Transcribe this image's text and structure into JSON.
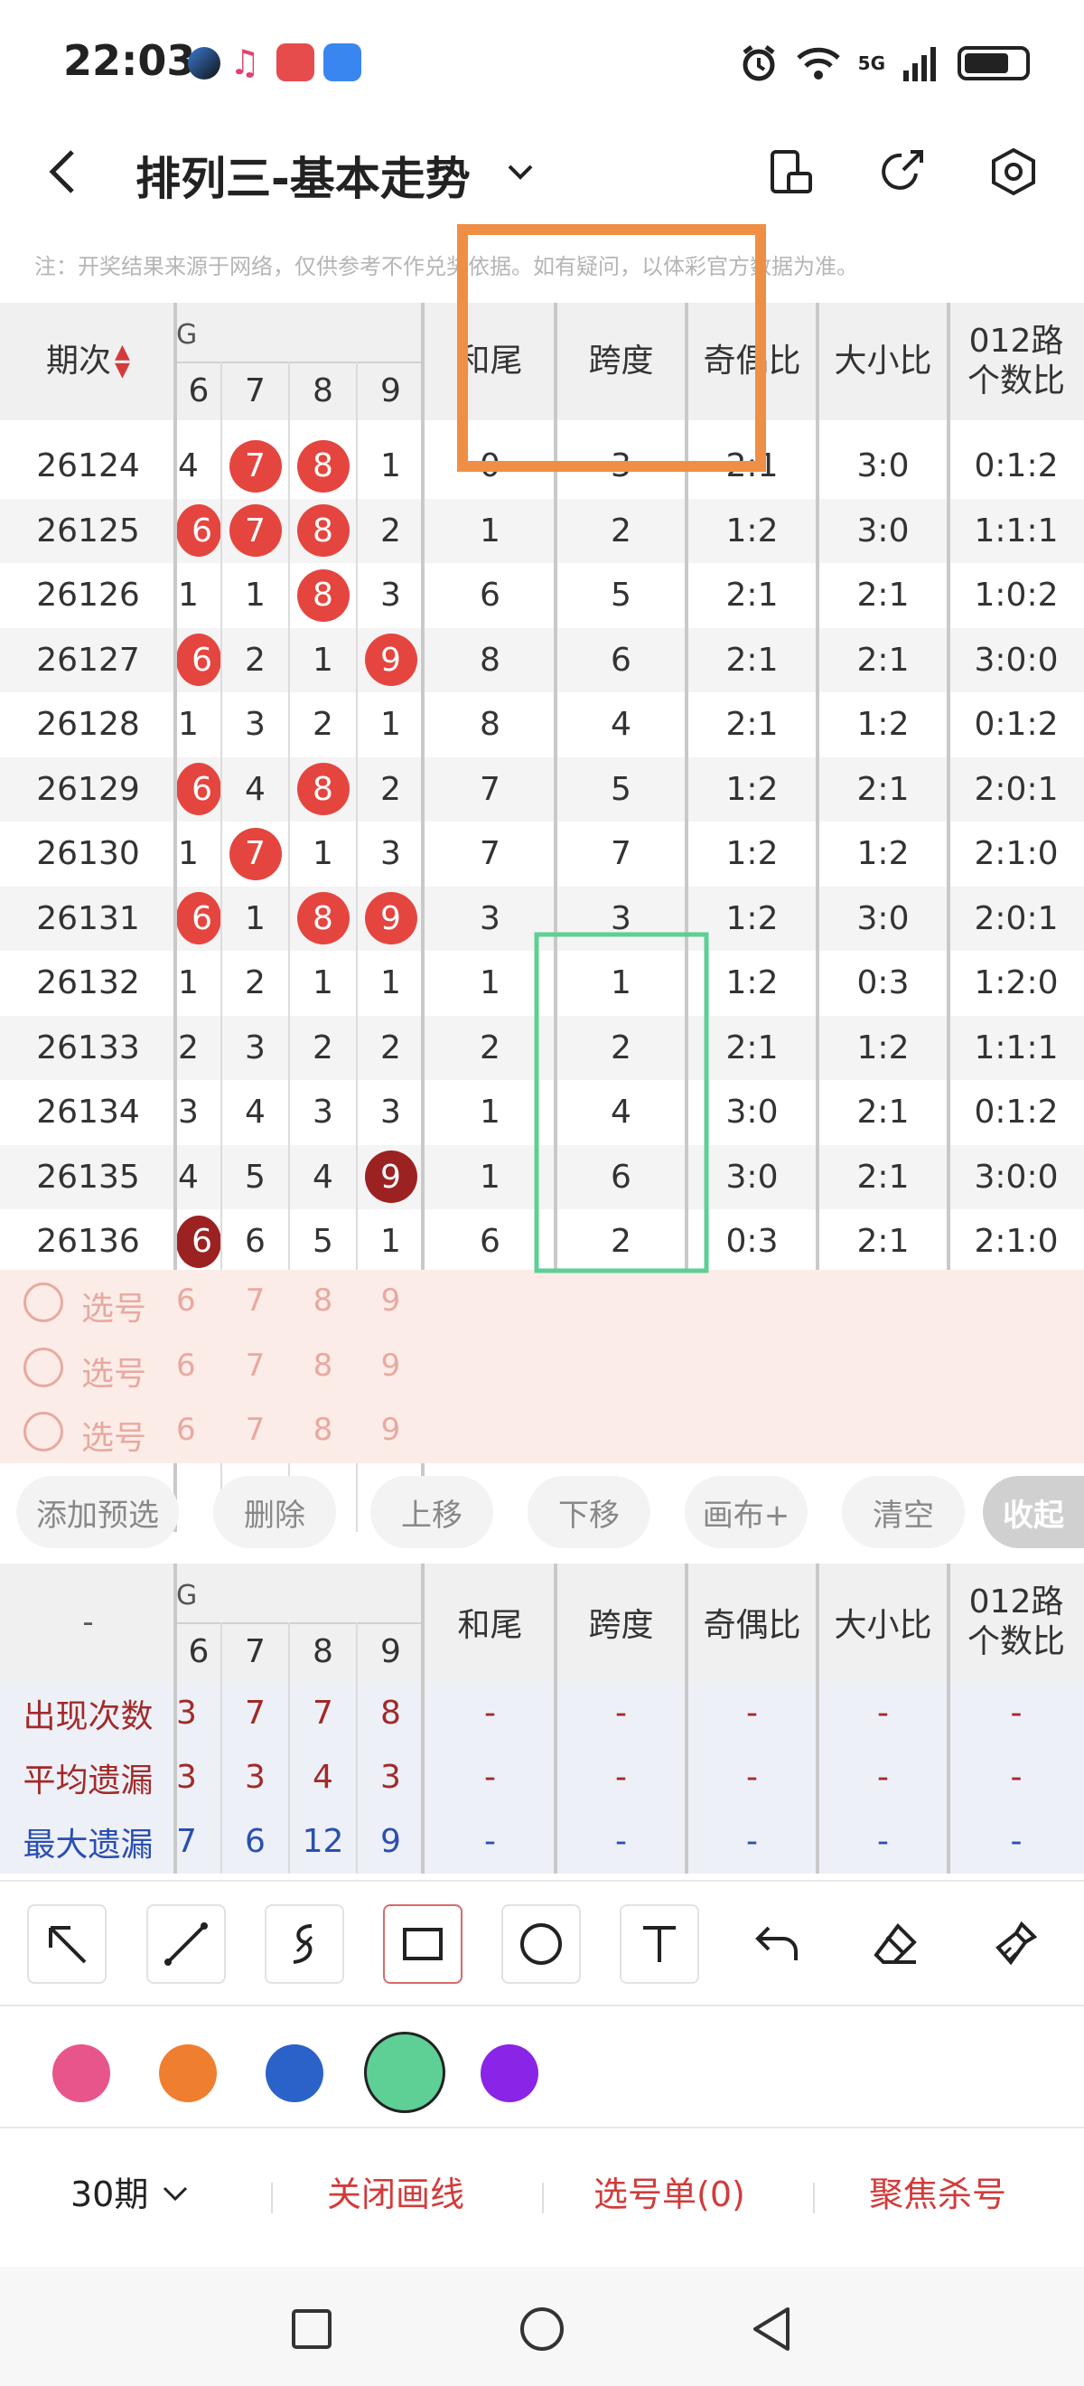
{
  "status_bar": {
    "time": "22:03",
    "network": "5G",
    "signal_superscript": "6",
    "battery_fraction": 0.75
  },
  "header": {
    "title": "排列三-基本走势",
    "back_icon": "chevron-left-icon",
    "dropdown_icon": "chevron-down-icon",
    "icons": [
      "phone-rotate-icon",
      "share-icon",
      "settings-icon"
    ]
  },
  "notice": "注：开奖结果来源于网络，仅供参考不作兑奖依据。如有疑问，以体彩官方数据为准。",
  "table": {
    "headers": {
      "period": "期次",
      "hewei": "和尾",
      "kuadu": "跨度",
      "jioubi": "奇偶比",
      "daxiaobi": "大小比",
      "lu012_line1": "012路",
      "lu012_line2": "个数比"
    },
    "partial_header": "G",
    "digit_cols": [
      "6",
      "7",
      "8",
      "9"
    ],
    "partial_row": {
      "period": "",
      "d6": "",
      "d7": "",
      "d8": "",
      "d9": "",
      "hewei": "",
      "kuadu": "",
      "jioubi": "",
      "daxiaobi": "",
      "lu012": ""
    },
    "rows": [
      {
        "period": "26124",
        "d": [
          "4",
          "7",
          "8",
          "1"
        ],
        "ball": [
          false,
          true,
          true,
          false
        ],
        "hewei": "0",
        "kuadu": "3",
        "jioubi": "2:1",
        "daxiaobi": "3:0",
        "lu012": "0:1:2"
      },
      {
        "period": "26125",
        "d": [
          "6",
          "7",
          "8",
          "2"
        ],
        "ball": [
          true,
          true,
          true,
          false
        ],
        "hewei": "1",
        "kuadu": "2",
        "jioubi": "1:2",
        "daxiaobi": "3:0",
        "lu012": "1:1:1"
      },
      {
        "period": "26126",
        "d": [
          "1",
          "1",
          "8",
          "3"
        ],
        "ball": [
          false,
          false,
          true,
          false
        ],
        "hewei": "6",
        "kuadu": "5",
        "jioubi": "2:1",
        "daxiaobi": "2:1",
        "lu012": "1:0:2"
      },
      {
        "period": "26127",
        "d": [
          "6",
          "2",
          "1",
          "9"
        ],
        "ball": [
          true,
          false,
          false,
          true
        ],
        "hewei": "8",
        "kuadu": "6",
        "jioubi": "2:1",
        "daxiaobi": "2:1",
        "lu012": "3:0:0"
      },
      {
        "period": "26128",
        "d": [
          "1",
          "3",
          "2",
          "1"
        ],
        "ball": [
          false,
          false,
          false,
          false
        ],
        "hewei": "8",
        "kuadu": "4",
        "jioubi": "2:1",
        "daxiaobi": "1:2",
        "lu012": "0:1:2"
      },
      {
        "period": "26129",
        "d": [
          "6",
          "4",
          "8",
          "2"
        ],
        "ball": [
          true,
          false,
          true,
          false
        ],
        "hewei": "7",
        "kuadu": "5",
        "jioubi": "1:2",
        "daxiaobi": "2:1",
        "lu012": "2:0:1"
      },
      {
        "period": "26130",
        "d": [
          "1",
          "7",
          "1",
          "3"
        ],
        "ball": [
          false,
          true,
          false,
          false
        ],
        "hewei": "7",
        "kuadu": "7",
        "jioubi": "1:2",
        "daxiaobi": "1:2",
        "lu012": "2:1:0"
      },
      {
        "period": "26131",
        "d": [
          "6",
          "1",
          "8",
          "9"
        ],
        "ball": [
          true,
          false,
          true,
          true
        ],
        "hewei": "3",
        "kuadu": "3",
        "jioubi": "1:2",
        "daxiaobi": "3:0",
        "lu012": "2:0:1"
      },
      {
        "period": "26132",
        "d": [
          "1",
          "2",
          "1",
          "1"
        ],
        "ball": [
          false,
          false,
          false,
          false
        ],
        "hewei": "1",
        "kuadu": "1",
        "jioubi": "1:2",
        "daxiaobi": "0:3",
        "lu012": "1:2:0"
      },
      {
        "period": "26133",
        "d": [
          "2",
          "3",
          "2",
          "2"
        ],
        "ball": [
          false,
          false,
          false,
          false
        ],
        "hewei": "2",
        "kuadu": "2",
        "jioubi": "2:1",
        "daxiaobi": "1:2",
        "lu012": "1:1:1"
      },
      {
        "period": "26134",
        "d": [
          "3",
          "4",
          "3",
          "3"
        ],
        "ball": [
          false,
          false,
          false,
          false
        ],
        "hewei": "1",
        "kuadu": "4",
        "jioubi": "3:0",
        "daxiaobi": "2:1",
        "lu012": "0:1:2"
      },
      {
        "period": "26135",
        "d": [
          "4",
          "5",
          "4",
          "9"
        ],
        "ball": [
          false,
          false,
          false,
          "dark"
        ],
        "hewei": "1",
        "kuadu": "6",
        "jioubi": "3:0",
        "daxiaobi": "2:1",
        "lu012": "3:0:0"
      },
      {
        "period": "26136",
        "d": [
          "6",
          "6",
          "5",
          "1"
        ],
        "ball": [
          "dark",
          false,
          false,
          false
        ],
        "hewei": "6",
        "kuadu": "2",
        "jioubi": "0:3",
        "daxiaobi": "2:1",
        "lu012": "2:1:0"
      }
    ],
    "pick_rows": [
      {
        "label": "选号",
        "nums": [
          "6",
          "7",
          "8",
          "9"
        ]
      },
      {
        "label": "选号",
        "nums": [
          "6",
          "7",
          "8",
          "9"
        ]
      },
      {
        "label": "选号",
        "nums": [
          "6",
          "7",
          "8",
          "9"
        ]
      }
    ]
  },
  "actions": [
    "添加预选",
    "删除",
    "上移",
    "下移",
    "画布+",
    "清空",
    "收起"
  ],
  "stats": {
    "corner": "-",
    "rows": [
      {
        "label": "出现次数",
        "d": [
          "3",
          "7",
          "7",
          "8"
        ],
        "rest": [
          "-",
          "-",
          "-",
          "-",
          "-"
        ],
        "color": "#a12a2a"
      },
      {
        "label": "平均遗漏",
        "d": [
          "3",
          "3",
          "4",
          "3"
        ],
        "rest": [
          "-",
          "-",
          "-",
          "-",
          "-"
        ],
        "color": "#a12a2a"
      },
      {
        "label": "最大遗漏",
        "d": [
          "7",
          "6",
          "12",
          "9"
        ],
        "rest": [
          "-",
          "-",
          "-",
          "-",
          "-"
        ],
        "color": "#2a4fb0"
      }
    ]
  },
  "tools": [
    "arrow-icon",
    "line-icon",
    "freehand-icon",
    "rectangle-icon",
    "circle-icon",
    "text-icon",
    "undo-icon",
    "eraser-icon",
    "clear-brush-icon"
  ],
  "colors": [
    "#e8558a",
    "#ef7e2f",
    "#2b62c9",
    "#5ecf95",
    "#8a24e6"
  ],
  "bottom": {
    "periods": "30期",
    "close_draw": "关闭画线",
    "selection": "选号单(0)",
    "focus": "聚焦杀号"
  },
  "accent": "#d23b3b"
}
